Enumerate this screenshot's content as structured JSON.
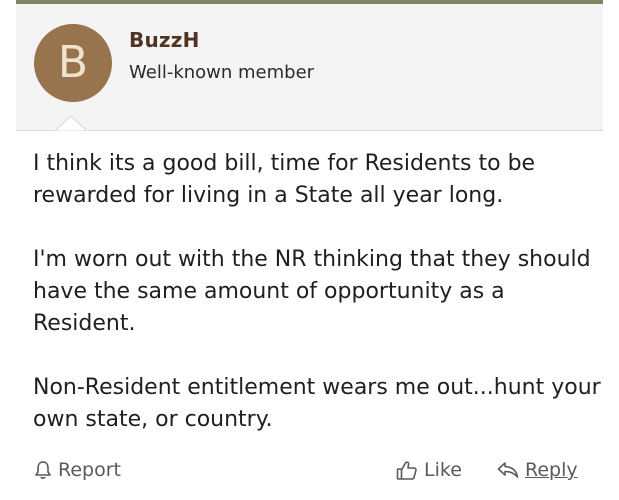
{
  "post": {
    "author": {
      "avatar_letter": "B",
      "avatar_color": "#97744d",
      "name": "BuzzH",
      "title": "Well-known member"
    },
    "paragraphs": [
      "I think its a good bill, time for Residents to be rewarded for living in a State all year long.",
      "I'm worn out with the NR thinking that they should have the same amount of opportunity as a Resident.",
      "Non-Resident entitlement wears me out...hunt your own state, or country."
    ]
  },
  "actions": {
    "report_label": "Report",
    "like_label": "Like",
    "reply_label": "Reply"
  },
  "icons": {
    "report": "bell-icon",
    "like": "thumbs-up-icon",
    "reply": "reply-arrow-icon"
  },
  "colors": {
    "accent_bar": "#7b8663",
    "username": "#4e3523",
    "header_bg": "#f4f4f4"
  }
}
